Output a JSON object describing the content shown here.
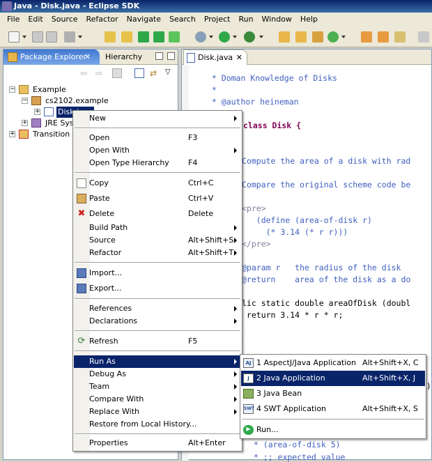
{
  "window": {
    "title": "Java - Disk.java - Eclipse SDK"
  },
  "menubar": [
    "File",
    "Edit",
    "Source",
    "Refactor",
    "Navigate",
    "Search",
    "Project",
    "Run",
    "Window",
    "Help"
  ],
  "explorer": {
    "tab_active": "Package Explorer",
    "tab_inactive": "Hierarchy",
    "tree": {
      "project": "Example",
      "package": "cs2102.example",
      "file": "Disk.java",
      "jre": "JRE Sys",
      "other_project": "Transition"
    }
  },
  "editor": {
    "tab": "Disk.java",
    "lines": [
      " * Doman Knowledge of Disks",
      " *",
      " * @author heineman",
      "class Disk {",
      "Compute the area of a disk with rad",
      "Compare the original scheme code be",
      "<pre>",
      "   (define (area-of-disk r)",
      "     (* 3.14 (* r r)))",
      "</pre>",
      "@param r   the radius of the disk",
      "@return    area of the disk as a do",
      "lic static double areaOfDisk (doubl",
      " return 3.14 * r * r;",
      "s)",
      " * (area-of-disk 5)",
      " * ;; expected value"
    ]
  },
  "context_menu": {
    "items": [
      {
        "label": "New",
        "submenu": true
      },
      {
        "label": "Open",
        "accel": "F3"
      },
      {
        "label": "Open With",
        "submenu": true
      },
      {
        "label": "Open Type Hierarchy",
        "accel": "F4"
      },
      {
        "label": "Copy",
        "accel": "Ctrl+C"
      },
      {
        "label": "Paste",
        "accel": "Ctrl+V"
      },
      {
        "label": "Delete",
        "accel": "Delete"
      },
      {
        "label": "Build Path",
        "submenu": true
      },
      {
        "label": "Source",
        "accel": "Alt+Shift+S",
        "submenu": true
      },
      {
        "label": "Refactor",
        "accel": "Alt+Shift+T",
        "submenu": true
      },
      {
        "label": "Import..."
      },
      {
        "label": "Export..."
      },
      {
        "label": "References",
        "submenu": true
      },
      {
        "label": "Declarations",
        "submenu": true
      },
      {
        "label": "Refresh",
        "accel": "F5"
      },
      {
        "label": "Run As",
        "submenu": true,
        "selected": true
      },
      {
        "label": "Debug As",
        "submenu": true
      },
      {
        "label": "Team",
        "submenu": true
      },
      {
        "label": "Compare With",
        "submenu": true
      },
      {
        "label": "Replace With",
        "submenu": true
      },
      {
        "label": "Restore from Local History..."
      },
      {
        "label": "Properties",
        "accel": "Alt+Enter"
      }
    ]
  },
  "run_as_submenu": {
    "items": [
      {
        "icon": "AJ",
        "label": "1 AspectJ/Java Application",
        "accel": "Alt+Shift+X, C"
      },
      {
        "icon": "J",
        "label": "2 Java Application",
        "accel": "Alt+Shift+X, J",
        "selected": true
      },
      {
        "icon": "",
        "label": "3 Java Bean",
        "accel": ""
      },
      {
        "icon": "SWT",
        "label": "4 SWT Application",
        "accel": "Alt+Shift+X, S"
      },
      {
        "icon": "",
        "label": "Run...",
        "accel": ""
      }
    ]
  },
  "colors": {
    "selection": "#0a246a",
    "title_gradient_start": "#0a246a",
    "javadoc": "#3f5fbf",
    "keyword": "#7f0055"
  }
}
